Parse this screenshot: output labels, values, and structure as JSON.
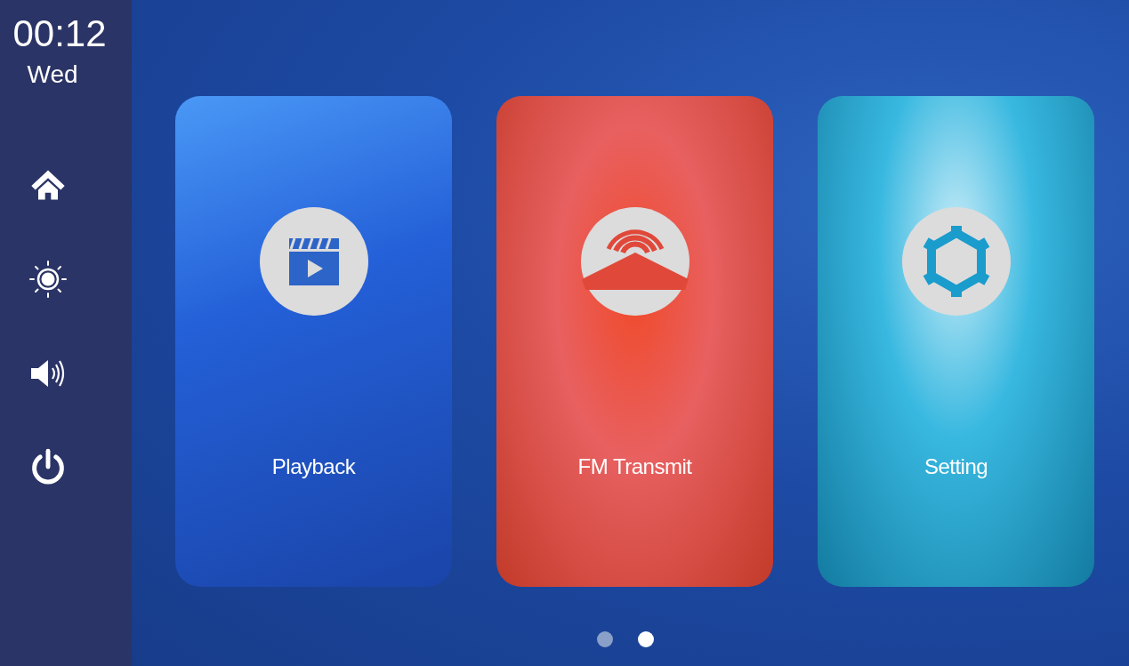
{
  "sidebar": {
    "time": "00:12",
    "day": "Wed",
    "buttons": [
      {
        "kind": "home"
      },
      {
        "kind": "brightness"
      },
      {
        "kind": "volume"
      },
      {
        "kind": "power"
      }
    ]
  },
  "cards": [
    {
      "kind": "playback",
      "label": "Playback"
    },
    {
      "kind": "fm",
      "label": "FM Transmit"
    },
    {
      "kind": "setting",
      "label": "Setting"
    }
  ],
  "pager": [
    {
      "selected": false
    },
    {
      "selected": true
    }
  ]
}
